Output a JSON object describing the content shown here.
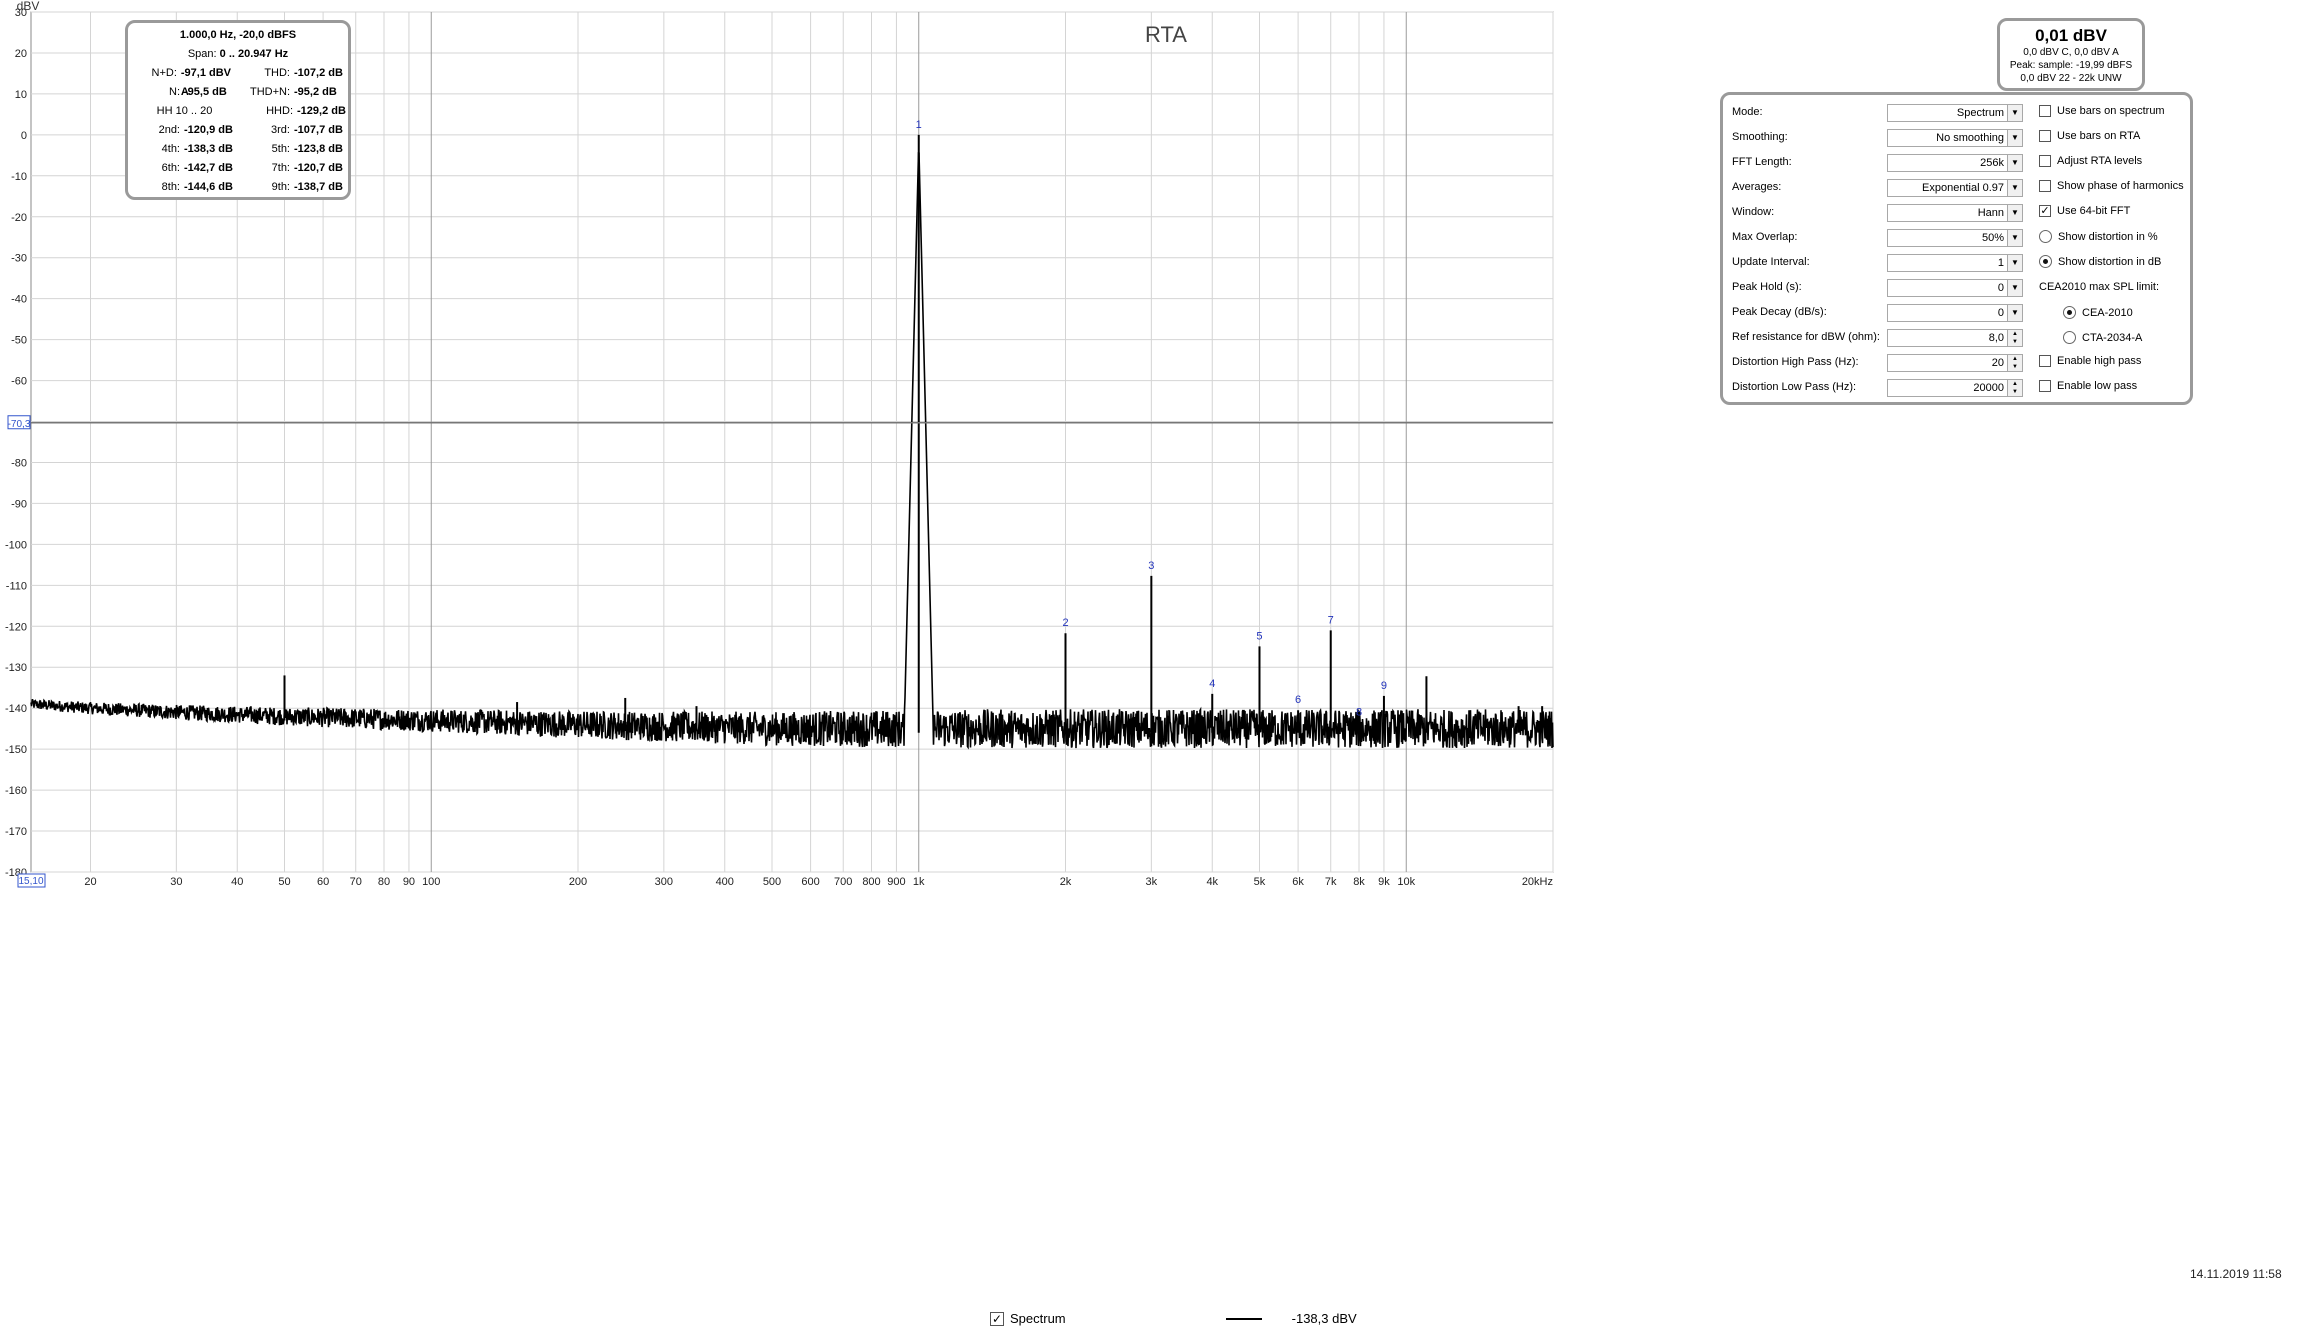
{
  "chart_data": {
    "type": "line",
    "title": "RTA",
    "ylabel": "dBV",
    "xlabel": "",
    "x_scale": "log",
    "xlim": [
      15.1,
      20000
    ],
    "ylim": [
      -180,
      30
    ],
    "yticks": [
      30,
      20,
      10,
      0,
      -10,
      -20,
      -30,
      -40,
      -50,
      -60,
      -70,
      -80,
      -90,
      -100,
      -110,
      -120,
      -130,
      -140,
      -150,
      -160,
      -170,
      -180
    ],
    "xticks": [
      {
        "v": 20,
        "t": "20"
      },
      {
        "v": 30,
        "t": "30"
      },
      {
        "v": 40,
        "t": "40"
      },
      {
        "v": 50,
        "t": "50"
      },
      {
        "v": 60,
        "t": "60"
      },
      {
        "v": 70,
        "t": "70"
      },
      {
        "v": 80,
        "t": "80"
      },
      {
        "v": 90,
        "t": "90"
      },
      {
        "v": 100,
        "t": "100"
      },
      {
        "v": 200,
        "t": "200"
      },
      {
        "v": 300,
        "t": "300"
      },
      {
        "v": 400,
        "t": "400"
      },
      {
        "v": 500,
        "t": "500"
      },
      {
        "v": 600,
        "t": "600"
      },
      {
        "v": 700,
        "t": "700"
      },
      {
        "v": 800,
        "t": "800"
      },
      {
        "v": 900,
        "t": "900"
      },
      {
        "v": 1000,
        "t": "1k"
      },
      {
        "v": 2000,
        "t": "2k"
      },
      {
        "v": 3000,
        "t": "3k"
      },
      {
        "v": 4000,
        "t": "4k"
      },
      {
        "v": 5000,
        "t": "5k"
      },
      {
        "v": 6000,
        "t": "6k"
      },
      {
        "v": 7000,
        "t": "7k"
      },
      {
        "v": 8000,
        "t": "8k"
      },
      {
        "v": 9000,
        "t": "9k"
      },
      {
        "v": 10000,
        "t": "10k"
      },
      {
        "v": 20000,
        "t": "20kHz"
      }
    ],
    "x_axis_start_label": "15,10",
    "cursor_level_label": "-70,3",
    "cursor_level": -70.3,
    "grid": true,
    "series": [
      {
        "name": "Spectrum",
        "color": "#000000",
        "noise_floor": [
          [
            15.1,
            -139
          ],
          [
            20,
            -140
          ],
          [
            30,
            -141
          ],
          [
            50,
            -142
          ],
          [
            100,
            -143
          ],
          [
            200,
            -144
          ],
          [
            500,
            -145
          ],
          [
            900,
            -145
          ],
          [
            1000,
            -145
          ],
          [
            2000,
            -145
          ],
          [
            5000,
            -145
          ],
          [
            10000,
            -145
          ],
          [
            20000,
            -145
          ]
        ],
        "peaks": [
          {
            "f": 50,
            "db": -132
          },
          {
            "f": 150,
            "db": -138.5
          },
          {
            "f": 250,
            "db": -137.5
          },
          {
            "f": 350,
            "db": -139.5
          },
          {
            "f": 1000,
            "db": 0
          },
          {
            "f": 2000,
            "db": -121.7
          },
          {
            "f": 3000,
            "db": -107.7
          },
          {
            "f": 4000,
            "db": -136.5
          },
          {
            "f": 5000,
            "db": -124.9
          },
          {
            "f": 6000,
            "db": -140.5
          },
          {
            "f": 7000,
            "db": -121.0
          },
          {
            "f": 8000,
            "db": -143.5
          },
          {
            "f": 9000,
            "db": -137.0
          },
          {
            "f": 11000,
            "db": -132.2
          },
          {
            "f": 17000,
            "db": -139.5
          },
          {
            "f": 19000,
            "db": -139.5
          }
        ]
      }
    ],
    "harmonic_markers": [
      {
        "label": "1",
        "f": 1000,
        "db": 0
      },
      {
        "label": "2",
        "f": 2000,
        "db": -121.7
      },
      {
        "label": "3",
        "f": 3000,
        "db": -107.7
      },
      {
        "label": "4",
        "f": 4000,
        "db": -136.5
      },
      {
        "label": "5",
        "f": 5000,
        "db": -124.9
      },
      {
        "label": "6",
        "f": 6000,
        "db": -140.5
      },
      {
        "label": "7",
        "f": 7000,
        "db": -121.0
      },
      {
        "label": "8",
        "f": 8000,
        "db": -143.5
      },
      {
        "label": "9",
        "f": 9000,
        "db": -137.0
      }
    ]
  },
  "distortion": {
    "header1": "1.000,0 Hz, -20,0 dBFS",
    "header2_prefix": "Span: ",
    "header2_value": "0 .. 20.947 Hz",
    "rows": [
      [
        {
          "l": "N+D:",
          "v": "-97,1 dBV A"
        },
        {
          "l": "THD:",
          "v": "-107,2 dB"
        }
      ],
      [
        {
          "l": "N:",
          "v": "-95,5 dB"
        },
        {
          "l": "THD+N:",
          "v": "-95,2 dB"
        }
      ],
      [
        {
          "l": "HH 10 .. 20",
          "v": ""
        },
        {
          "l": "HHD:",
          "v": "-129,2 dB"
        }
      ],
      [
        {
          "l": "2nd:",
          "v": "-120,9 dB"
        },
        {
          "l": "3rd:",
          "v": "-107,7 dB"
        }
      ],
      [
        {
          "l": "4th:",
          "v": "-138,3 dB"
        },
        {
          "l": "5th:",
          "v": "-123,8 dB"
        }
      ],
      [
        {
          "l": "6th:",
          "v": "-142,7 dB"
        },
        {
          "l": "7th:",
          "v": "-120,7 dB"
        }
      ],
      [
        {
          "l": "8th:",
          "v": "-144,6 dB"
        },
        {
          "l": "9th:",
          "v": "-138,7 dB"
        }
      ]
    ]
  },
  "level": {
    "main": "0,01 dBV",
    "line1": "0,0 dBV C, 0,0 dBV A",
    "line2": "Peak: sample: -19,99 dBFS",
    "line3": "0,0 dBV 22 - 22k UNW"
  },
  "controls": {
    "rows": [
      {
        "label": "Mode:",
        "value": "Spectrum",
        "kind": "select",
        "check": {
          "label": "Use bars on spectrum",
          "checked": false
        }
      },
      {
        "label": "Smoothing:",
        "value": "No  smoothing",
        "kind": "select",
        "check": {
          "label": "Use bars on RTA",
          "checked": false
        }
      },
      {
        "label": "FFT Length:",
        "value": "256k",
        "kind": "select",
        "check": {
          "label": "Adjust RTA levels",
          "checked": false
        }
      },
      {
        "label": "Averages:",
        "value": "Exponential 0.97",
        "kind": "select",
        "check": {
          "label": "Show phase of harmonics",
          "checked": false
        }
      },
      {
        "label": "Window:",
        "value": "Hann",
        "kind": "select",
        "check": {
          "label": "Use 64-bit FFT",
          "checked": true
        }
      },
      {
        "label": "Max Overlap:",
        "value": "50%",
        "kind": "select",
        "radio": {
          "label": "Show distortion in %",
          "checked": false
        }
      },
      {
        "label": "Update Interval:",
        "value": "1",
        "kind": "select",
        "radio": {
          "label": "Show distortion in dB",
          "checked": true
        }
      },
      {
        "label": "Peak Hold (s):",
        "value": "0",
        "kind": "select",
        "title": "CEA2010 max SPL limit:"
      },
      {
        "label": "Peak Decay (dB/s):",
        "value": "0",
        "kind": "select",
        "cea": {
          "label": "CEA-2010",
          "checked": true
        }
      },
      {
        "label": "Ref resistance for dBW (ohm):",
        "value": "8,0",
        "kind": "spin",
        "cea": {
          "label": "CTA-2034-A",
          "checked": false
        }
      },
      {
        "label": "Distortion High Pass (Hz):",
        "value": "20",
        "kind": "spin",
        "check": {
          "label": "Enable high pass",
          "checked": false
        }
      },
      {
        "label": "Distortion Low Pass (Hz):",
        "value": "20000",
        "kind": "spin",
        "check": {
          "label": "Enable low pass",
          "checked": false
        }
      }
    ]
  },
  "legend": {
    "checkbox_label": "Spectrum",
    "checked": true,
    "value": "-138,3 dBV"
  },
  "timestamp": "14.11.2019 11:58"
}
